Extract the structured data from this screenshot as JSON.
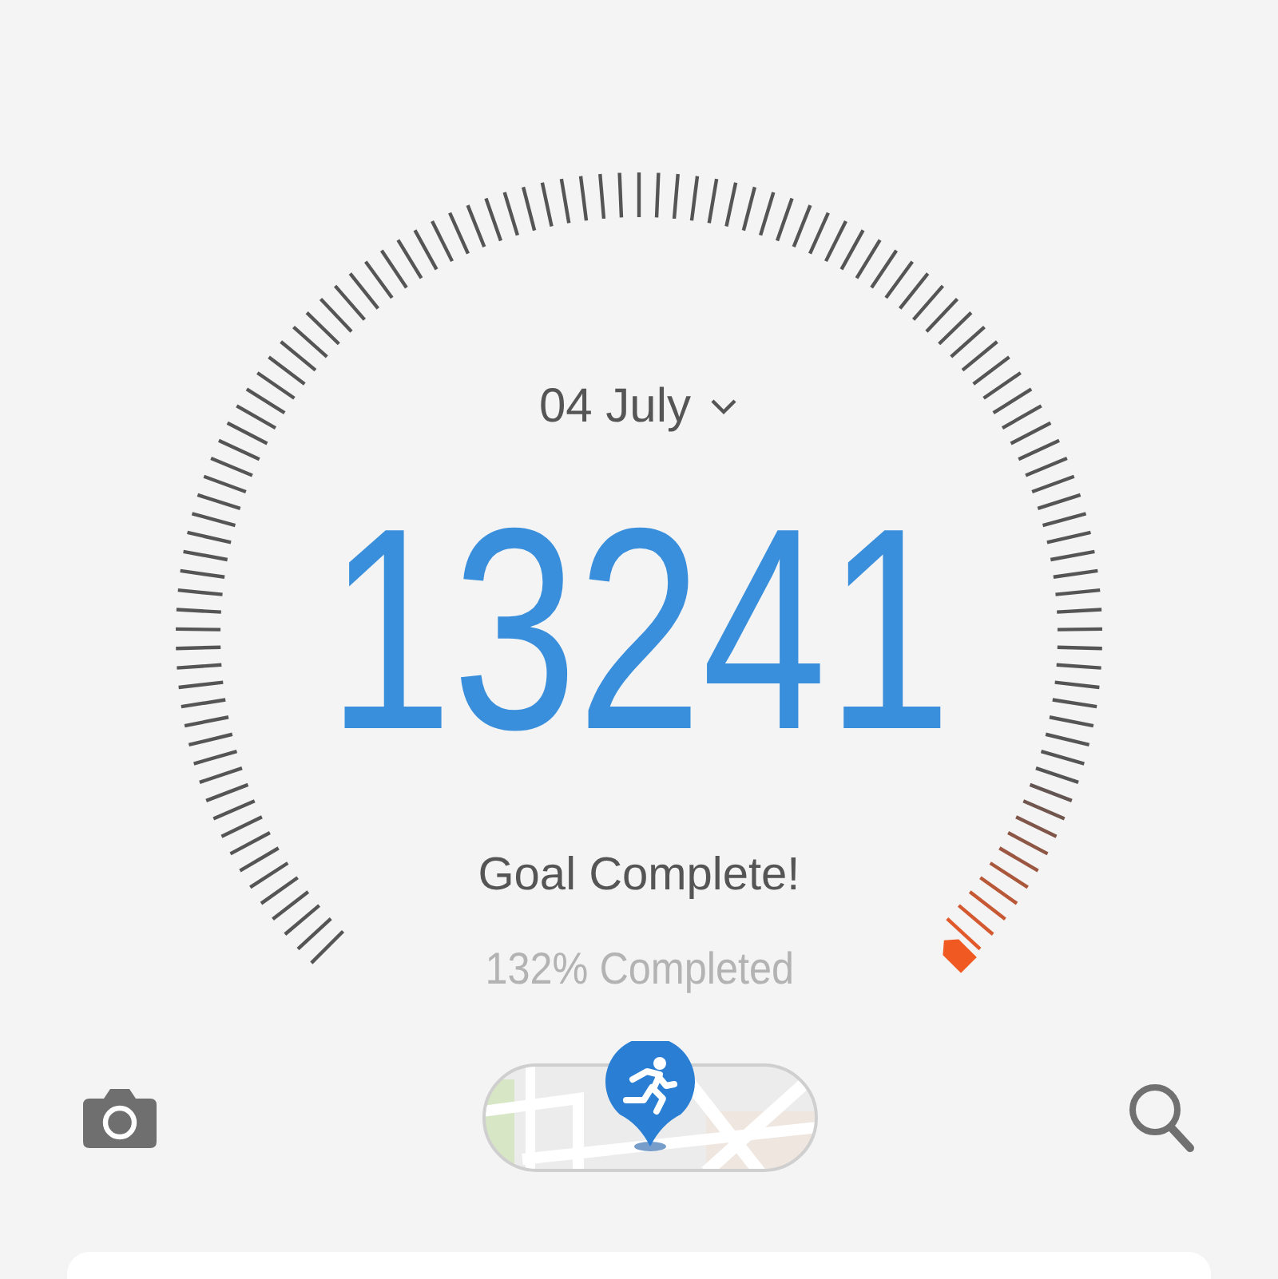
{
  "date_selector": {
    "label": "04 July"
  },
  "steps": "13241",
  "goal": {
    "status": "Goal Complete!",
    "progress": "132% Completed"
  }
}
